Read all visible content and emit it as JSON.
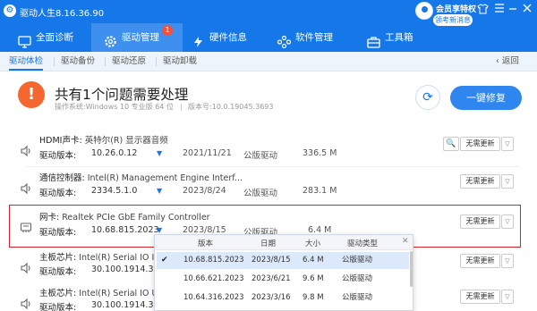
{
  "app": {
    "title": "驱动人生8.16.36.90",
    "vip_text": "会员享特权",
    "claim_text": "领考新消息",
    "window_controls": [
      "shirt-icon",
      "menu-icon",
      "minimize-icon",
      "close-icon"
    ]
  },
  "main_nav": {
    "tabs": [
      {
        "label": "全面诊断",
        "icon": "monitor-icon"
      },
      {
        "label": "驱动管理",
        "icon": "gear-icon",
        "badge": "1",
        "active": true
      },
      {
        "label": "硬件信息",
        "icon": "chip-icon"
      },
      {
        "label": "软件管理",
        "icon": "apps-icon"
      },
      {
        "label": "工具箱",
        "icon": "toolbox-icon"
      }
    ]
  },
  "sub_nav": {
    "tabs": [
      "驱动体检",
      "驱动备份",
      "驱动还原",
      "驱动卸载"
    ],
    "active": "驱动体检",
    "back_label": "返回"
  },
  "summary": {
    "headline": "共有1个问题需要处理",
    "os_label": "操作系统:",
    "os_value": "Windows 10 专业版 64 位",
    "version_label": "版本号:",
    "version_value": "10.0.19045.3693",
    "fix_button": "一键修复"
  },
  "drivers": [
    {
      "category": "HDMI声卡:",
      "name": "英特尔(R) 显示器音频",
      "version_label": "驱动版本:",
      "version": "10.26.0.12",
      "date": "2021/11/21",
      "type": "公版驱动",
      "size": "336.5 M",
      "action": "无需更新",
      "icon": "speaker-icon",
      "has_search": true
    },
    {
      "category": "通信控制器:",
      "name": "Intel(R) Management Engine Interf...",
      "version_label": "驱动版本:",
      "version": "2334.5.1.0",
      "date": "2023/8/24",
      "type": "公版驱动",
      "size": "283.1 M",
      "action": "无需更新",
      "icon": "speaker-icon",
      "has_search": false
    },
    {
      "category": "网卡:",
      "name": "Realtek PCIe GbE Family Controller",
      "version_label": "驱动版本:",
      "version": "10.68.815.2023",
      "date": "2023/8/15",
      "type": "公版驱动",
      "size": "6.4 M",
      "action": "无需更新",
      "icon": "network-card-icon",
      "has_search": false,
      "highlighted": true
    },
    {
      "category": "主板芯片:",
      "name": "Intel(R) Serial IO I...",
      "version_label": "驱动版本:",
      "version": "30.100.1914.3",
      "action": "无需更新",
      "icon": "speaker-icon"
    },
    {
      "category": "主板芯片:",
      "name": "Intel(R) Serial IO U...",
      "version_label": "驱动版本:",
      "version": "30.100.1914.3",
      "action": "无需更新",
      "icon": "speaker-icon"
    }
  ],
  "version_popup": {
    "headers": [
      "版本",
      "日期",
      "大小",
      "驱动类型"
    ],
    "rows": [
      {
        "version": "10.68.815.2023",
        "date": "2023/8/15",
        "size": "6.4 M",
        "type": "公版驱动",
        "selected": true
      },
      {
        "version": "10.66.621.2023",
        "date": "2023/6/21",
        "size": "9.6 M",
        "type": "公版驱动"
      },
      {
        "version": "10.64.316.2023",
        "date": "2023/3/16",
        "size": "9.8 M",
        "type": "公版驱动"
      }
    ]
  }
}
